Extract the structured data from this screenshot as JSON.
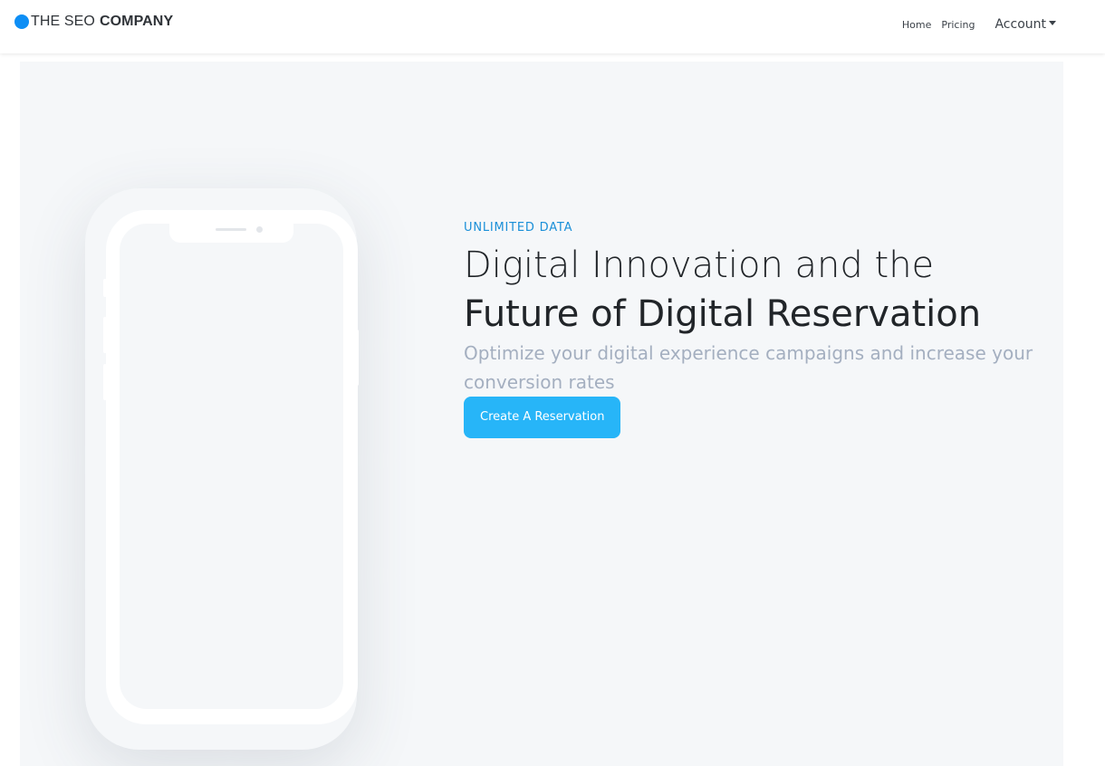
{
  "brand": {
    "name_light": "THE SEO",
    "name_bold": "COMPANY",
    "logo_color": "#0d8ef5"
  },
  "nav": {
    "home": "Home",
    "pricing": "Pricing",
    "account": "Account"
  },
  "hero": {
    "eyebrow": "UNLIMITED DATA",
    "headline_light": "Digital Innovation and the",
    "headline_strong": "Future of Digital Reservation",
    "subheadline": "Optimize your digital experience campaigns and increase your conversion rates",
    "cta_label": "Create A Reservation",
    "accent_color": "#27b5f8"
  }
}
